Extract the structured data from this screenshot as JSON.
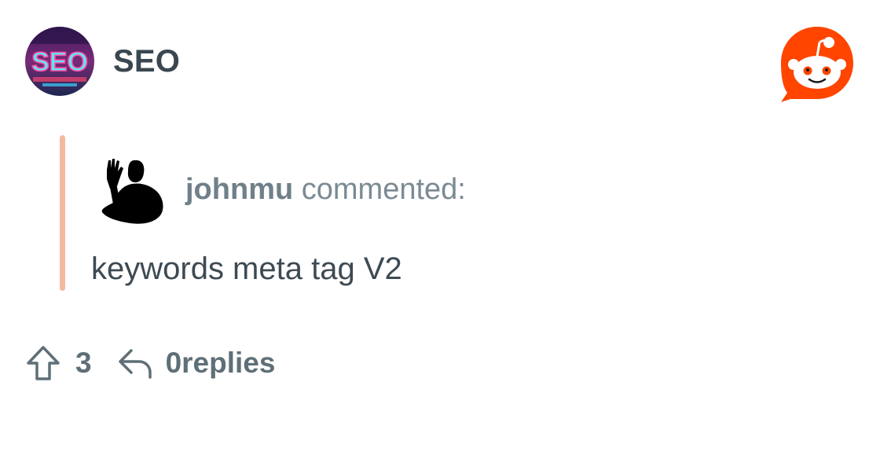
{
  "header": {
    "subreddit_name": "SEO",
    "subreddit_avatar_text": "SEO",
    "subreddit_avatar_icon": "seo-neon-sign",
    "brand_logo_icon": "reddit-snoo-logo"
  },
  "comment": {
    "username": "johnmu",
    "action_text": "commented:",
    "body": "keywords meta tag V2",
    "avatar_icon": "waving-silhouette"
  },
  "actions": {
    "upvote_count": "3",
    "replies_label": "0replies",
    "upvote_icon": "upvote-arrow-icon",
    "reply_icon": "reply-arrow-icon"
  },
  "colors": {
    "quote_bar": "#f4b9a3",
    "reddit_orange": "#ff4500",
    "text_dark": "#3a4750",
    "text_muted": "#7b8a93"
  }
}
